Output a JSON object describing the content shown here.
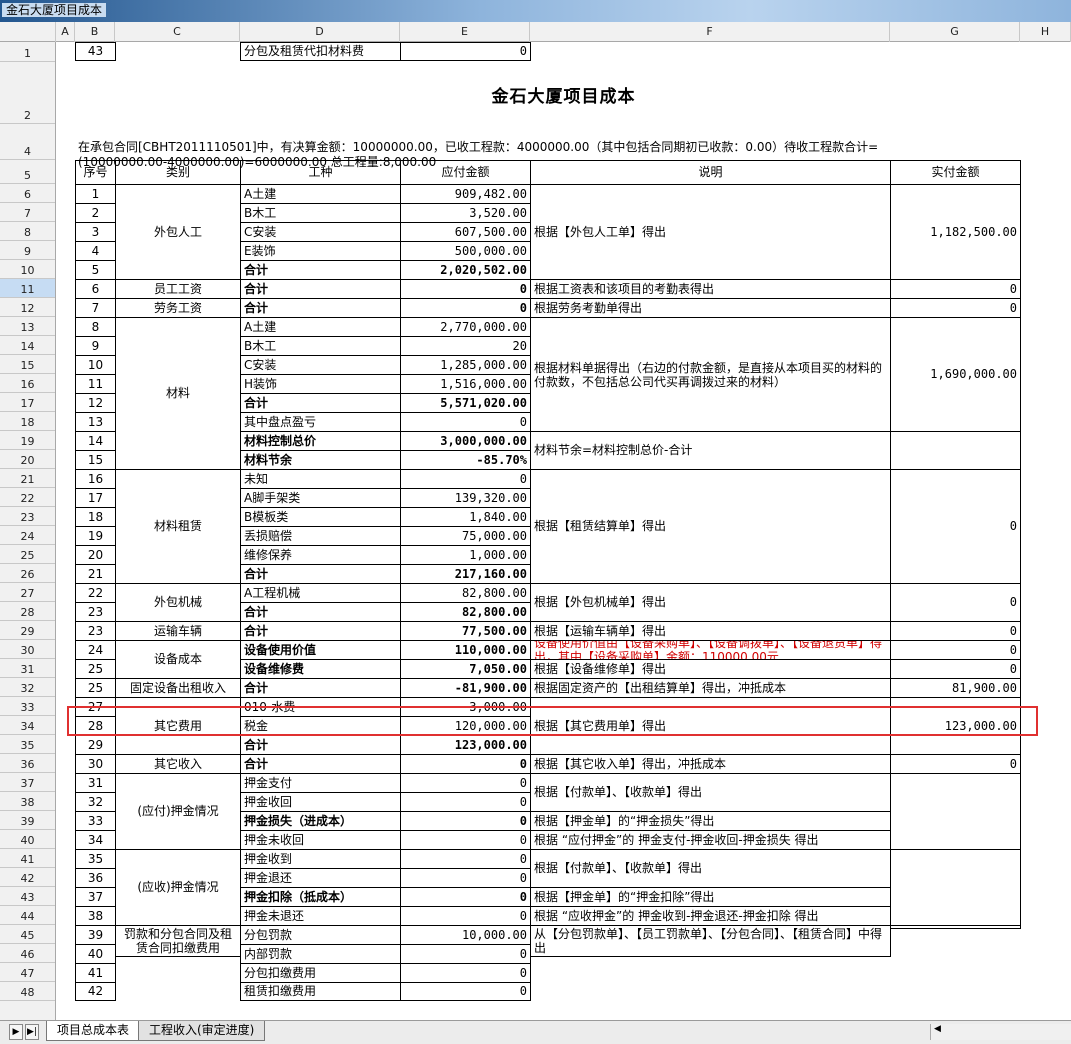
{
  "window": {
    "title": "金石大厦项目成本"
  },
  "columns": [
    "A",
    "B",
    "C",
    "D",
    "E",
    "F",
    "G",
    "H"
  ],
  "rows": [
    "1",
    "2",
    "4",
    "5",
    "6",
    "7",
    "8",
    "9",
    "10",
    "11",
    "12",
    "13",
    "14",
    "15",
    "16",
    "17",
    "18",
    "19",
    "20",
    "21",
    "22",
    "23",
    "24",
    "25",
    "26",
    "27",
    "28",
    "29",
    "30",
    "31",
    "32",
    "33",
    "34",
    "35",
    "36",
    "37",
    "38",
    "39",
    "40",
    "41",
    "42",
    "43",
    "44",
    "45",
    "46",
    "47",
    "48"
  ],
  "selected_row": "11",
  "doc": {
    "title": "金石大厦项目成本",
    "summary": "在承包合同[CBHT2011110501]中，有决算金额：10000000.00，已收工程款：4000000.00（其中包括合同期初已收款：0.00）待收工程款合计=(10000000.00-4000000.00)=6000000.00  总工程量:8,000.00"
  },
  "table": {
    "headers": {
      "seq": "序号",
      "category": "类别",
      "type": "工种",
      "payable": "应付金额",
      "note": "说明",
      "paid": "实付金额"
    },
    "groups": [
      {
        "category": "外包人工",
        "note": "根据【外包人工单】得出",
        "paid": "1,182,500.00"
      },
      {
        "category": "员工工资",
        "note": "根据工资表和该项目的考勤表得出",
        "paid": "0"
      },
      {
        "category": "劳务工资",
        "note": "根据劳务考勤单得出",
        "paid": "0"
      },
      {
        "category": "材料",
        "note": "根据材料单据得出（右边的付款金额，是直接从本项目买的材料的付款数，不包括总公司代买再调拨过来的材料）",
        "paid": "1,690,000.00"
      },
      {
        "note": "材料节余=材料控制总价-合计"
      },
      {
        "category": "材料租赁",
        "note": "根据【租赁结算单】得出",
        "paid": "0"
      },
      {
        "category": "外包机械",
        "note": "根据【外包机械单】得出",
        "paid": "0"
      },
      {
        "category": "运输车辆",
        "note": "根据【运输车辆单】得出",
        "paid": "0"
      },
      {
        "category": "设备成本",
        "note": "设备使用价值由【设备采购单】、【设备调拨单】、【设备退货单】得出，其中【设备采购单】金额：110000.00元",
        "paid": "0",
        "note2": "根据【设备维修单】得出",
        "paid2": "0"
      },
      {
        "category": "固定设备出租收入",
        "note": "根据固定资产的【出租结算单】得出，冲抵成本",
        "paid": "81,900.00"
      },
      {
        "category": "其它费用",
        "note": "根据【其它费用单】得出",
        "paid": "123,000.00"
      },
      {
        "category": "其它收入",
        "note": "根据【其它收入单】得出，冲抵成本",
        "paid": "0"
      },
      {
        "category": "(应付)押金情况",
        "note": "根据【付款单】、【收款单】得出",
        "note2": "根据【押金单】的“押金损失”得出",
        "note3": "根据  “应付押金”的 押金支付-押金收回-押金损失 得出"
      },
      {
        "category": "(应收)押金情况",
        "note": "根据【付款单】、【收款单】得出",
        "note2": "根据【押金单】的“押金扣除”得出",
        "note3": "根据  “应收押金”的 押金收到-押金退还-押金扣除 得出"
      },
      {
        "category": "罚款和分包合同及租赁合同扣缴费用",
        "note": "从【分包罚款单】、【员工罚款单】、【分包合同】、【租赁合同】中得出"
      }
    ],
    "rows": [
      {
        "seq": "1",
        "type": "A土建",
        "payable": "909,482.00"
      },
      {
        "seq": "2",
        "type": "B木工",
        "payable": "3,520.00"
      },
      {
        "seq": "3",
        "type": "C安装",
        "payable": "607,500.00"
      },
      {
        "seq": "4",
        "type": "E装饰",
        "payable": "500,000.00"
      },
      {
        "seq": "5",
        "type": "合计",
        "payable": "2,020,502.00"
      },
      {
        "seq": "6",
        "type": "合计",
        "payable": "0"
      },
      {
        "seq": "7",
        "type": "合计",
        "payable": "0"
      },
      {
        "seq": "8",
        "type": "A土建",
        "payable": "2,770,000.00"
      },
      {
        "seq": "9",
        "type": "B木工",
        "payable": "20"
      },
      {
        "seq": "10",
        "type": "C安装",
        "payable": "1,285,000.00"
      },
      {
        "seq": "11",
        "type": "H装饰",
        "payable": "1,516,000.00"
      },
      {
        "seq": "12",
        "type": "合计",
        "payable": "5,571,020.00"
      },
      {
        "seq": "13",
        "type": "其中盘点盈亏",
        "payable": "0"
      },
      {
        "seq": "14",
        "type": "材料控制总价",
        "payable": "3,000,000.00"
      },
      {
        "seq": "15",
        "type": "材料节余",
        "payable": "-85.70%"
      },
      {
        "seq": "16",
        "type": "未知",
        "payable": "0"
      },
      {
        "seq": "17",
        "type": "A脚手架类",
        "payable": "139,320.00"
      },
      {
        "seq": "18",
        "type": "B模板类",
        "payable": "1,840.00"
      },
      {
        "seq": "19",
        "type": "丢损赔偿",
        "payable": "75,000.00"
      },
      {
        "seq": "20",
        "type": "维修保养",
        "payable": "1,000.00"
      },
      {
        "seq": "21",
        "type": "合计",
        "payable": "217,160.00"
      },
      {
        "seq": "22",
        "type": "A工程机械",
        "payable": "82,800.00"
      },
      {
        "seq": "23",
        "type": "合计",
        "payable": "82,800.00"
      },
      {
        "seq": "23",
        "type": "合计",
        "payable": "77,500.00"
      },
      {
        "seq": "24",
        "type": "设备使用价值",
        "payable": "110,000.00"
      },
      {
        "seq": "25",
        "type": "设备维修费",
        "payable": "7,050.00"
      },
      {
        "seq": "25",
        "type": "合计",
        "payable": "-81,900.00"
      },
      {
        "seq": "27",
        "type": "010-水费",
        "payable": "3,000.00"
      },
      {
        "seq": "28",
        "type": "税金",
        "payable": "120,000.00"
      },
      {
        "seq": "29",
        "type": "合计",
        "payable": "123,000.00"
      },
      {
        "seq": "30",
        "type": "合计",
        "payable": "0"
      },
      {
        "seq": "31",
        "type": "押金支付",
        "payable": "0"
      },
      {
        "seq": "32",
        "type": "押金收回",
        "payable": "0"
      },
      {
        "seq": "33",
        "type": "押金损失（进成本）",
        "payable": "0"
      },
      {
        "seq": "34",
        "type": "押金未收回",
        "payable": "0"
      },
      {
        "seq": "35",
        "type": "押金收到",
        "payable": "0"
      },
      {
        "seq": "36",
        "type": "押金退还",
        "payable": "0"
      },
      {
        "seq": "37",
        "type": "押金扣除（抵成本）",
        "payable": "0"
      },
      {
        "seq": "38",
        "type": "押金未退还",
        "payable": "0"
      },
      {
        "seq": "39",
        "type": "分包罚款",
        "payable": "10,000.00"
      },
      {
        "seq": "40",
        "type": "内部罚款",
        "payable": "0"
      },
      {
        "seq": "41",
        "type": "分包扣缴费用",
        "payable": "0"
      },
      {
        "seq": "42",
        "type": "租赁扣缴费用",
        "payable": "0"
      },
      {
        "seq": "43",
        "type": "分包及租赁代扣材料费",
        "payable": "0"
      }
    ]
  },
  "tabs": [
    {
      "label": "项目总成本表",
      "active": true
    },
    {
      "label": "工程收入(审定进度)",
      "active": false
    }
  ],
  "colors": {
    "highlight": "#e03030",
    "red_text": "#d00000"
  }
}
